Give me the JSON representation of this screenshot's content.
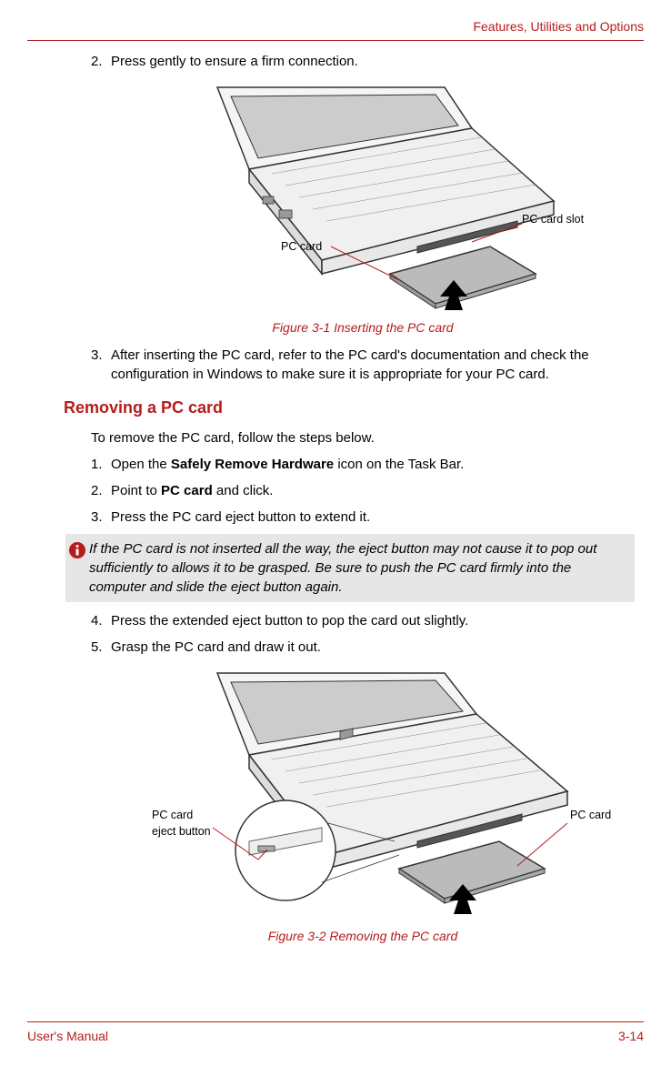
{
  "header": {
    "section_title": "Features, Utilities and Options"
  },
  "steps_top": {
    "s2": {
      "num": "2.",
      "text": "Press gently to ensure a firm connection."
    }
  },
  "figure1": {
    "label_pc_card": "PC card",
    "label_pc_card_slot": "PC card slot",
    "caption": "Figure 3-1 Inserting the PC card"
  },
  "steps_mid": {
    "s3": {
      "num": "3.",
      "text": "After inserting the PC card, refer to the PC card's documentation and check the configuration in Windows to make sure it is appropriate for your PC card."
    }
  },
  "section_heading": "Removing a PC card",
  "intro": "To remove the PC card, follow the steps below.",
  "remove_steps": {
    "s1": {
      "num": "1.",
      "pre": "Open the ",
      "bold": "Safely Remove Hardware",
      "post": " icon on the Task Bar."
    },
    "s2": {
      "num": "2.",
      "pre": "Point to ",
      "bold": "PC card",
      "post": " and click."
    },
    "s3": {
      "num": "3.",
      "text": "Press the PC card eject button to extend it."
    }
  },
  "note": "If the PC card is not inserted all the way, the eject button may not cause it to pop out sufficiently to allows it to be grasped. Be sure to push the PC card firmly into the computer and slide the eject button again.",
  "remove_steps_cont": {
    "s4": {
      "num": "4.",
      "text": "Press the extended eject button to pop the card out slightly."
    },
    "s5": {
      "num": "5.",
      "text": "Grasp the PC card and draw it out."
    }
  },
  "figure2": {
    "label_eject": "PC card\neject button",
    "label_eject_line1": "PC card",
    "label_eject_line2": "eject button",
    "label_pc_card": "PC card",
    "caption": "Figure 3-2 Removing the PC card"
  },
  "footer": {
    "left": "User's Manual",
    "right": "3-14"
  }
}
